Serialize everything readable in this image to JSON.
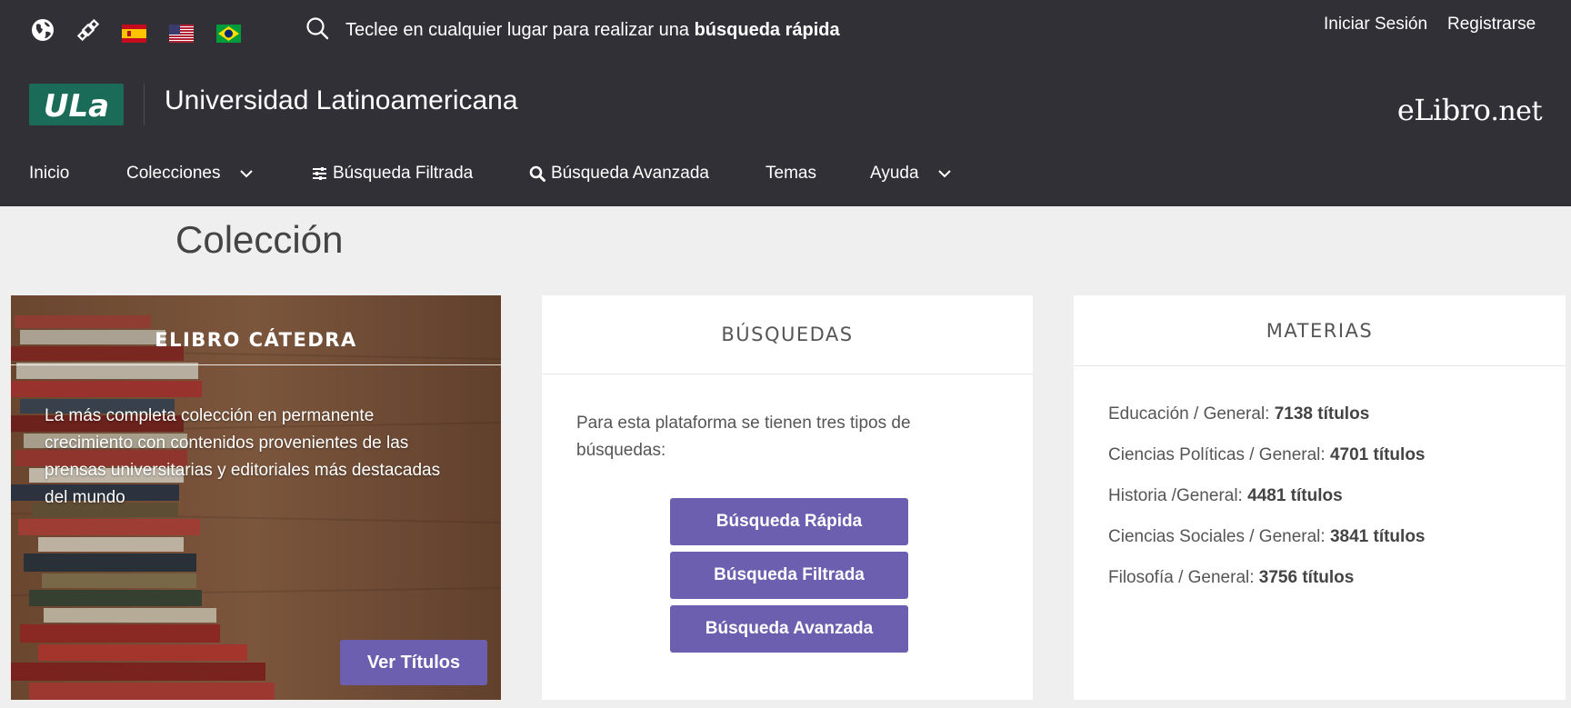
{
  "topbar": {
    "quick_search_prefix": "Teclee en cualquier lugar para realizar una ",
    "quick_search_bold": "búsqueda rápida",
    "login": "Iniciar Sesión",
    "register": "Registrarse"
  },
  "brand": {
    "logo_text": "ULa",
    "university": "Universidad Latinoamericana",
    "elibro_main": "eLibro",
    "elibro_suffix": ".net"
  },
  "nav": [
    {
      "label": "Inicio"
    },
    {
      "label": "Colecciones"
    },
    {
      "label": "Búsqueda Filtrada"
    },
    {
      "label": "Búsqueda Avanzada"
    },
    {
      "label": "Temas"
    },
    {
      "label": "Ayuda"
    }
  ],
  "page": {
    "title": "Colección"
  },
  "catedra": {
    "title": "ELIBRO CÁTEDRA",
    "description": "La más completa colección en permanente crecimiento con contenidos provenientes de las prensas universitarias y editoriales más destacadas del mundo",
    "button": "Ver Títulos"
  },
  "busquedas": {
    "title": "BÚSQUEDAS",
    "description": "Para esta plataforma se tienen tres tipos de búsquedas:",
    "buttons": [
      "Búsqueda Rápida",
      "Búsqueda Filtrada",
      "Búsqueda Avanzada"
    ]
  },
  "materias": {
    "title": "MATERIAS",
    "items": [
      {
        "name": "Educación / General: ",
        "count": "7138 títulos"
      },
      {
        "name": "Ciencias Políticas / General: ",
        "count": "4701 títulos"
      },
      {
        "name": "Historia /General: ",
        "count": "4481 títulos"
      },
      {
        "name": "Ciencias Sociales / General: ",
        "count": "3841 títulos"
      },
      {
        "name": "Filosofía / General: ",
        "count": "3756 títulos"
      }
    ]
  },
  "colors": {
    "header_bg": "#313037",
    "accent_button": "#6c5fb0",
    "page_bg": "#efefef"
  }
}
